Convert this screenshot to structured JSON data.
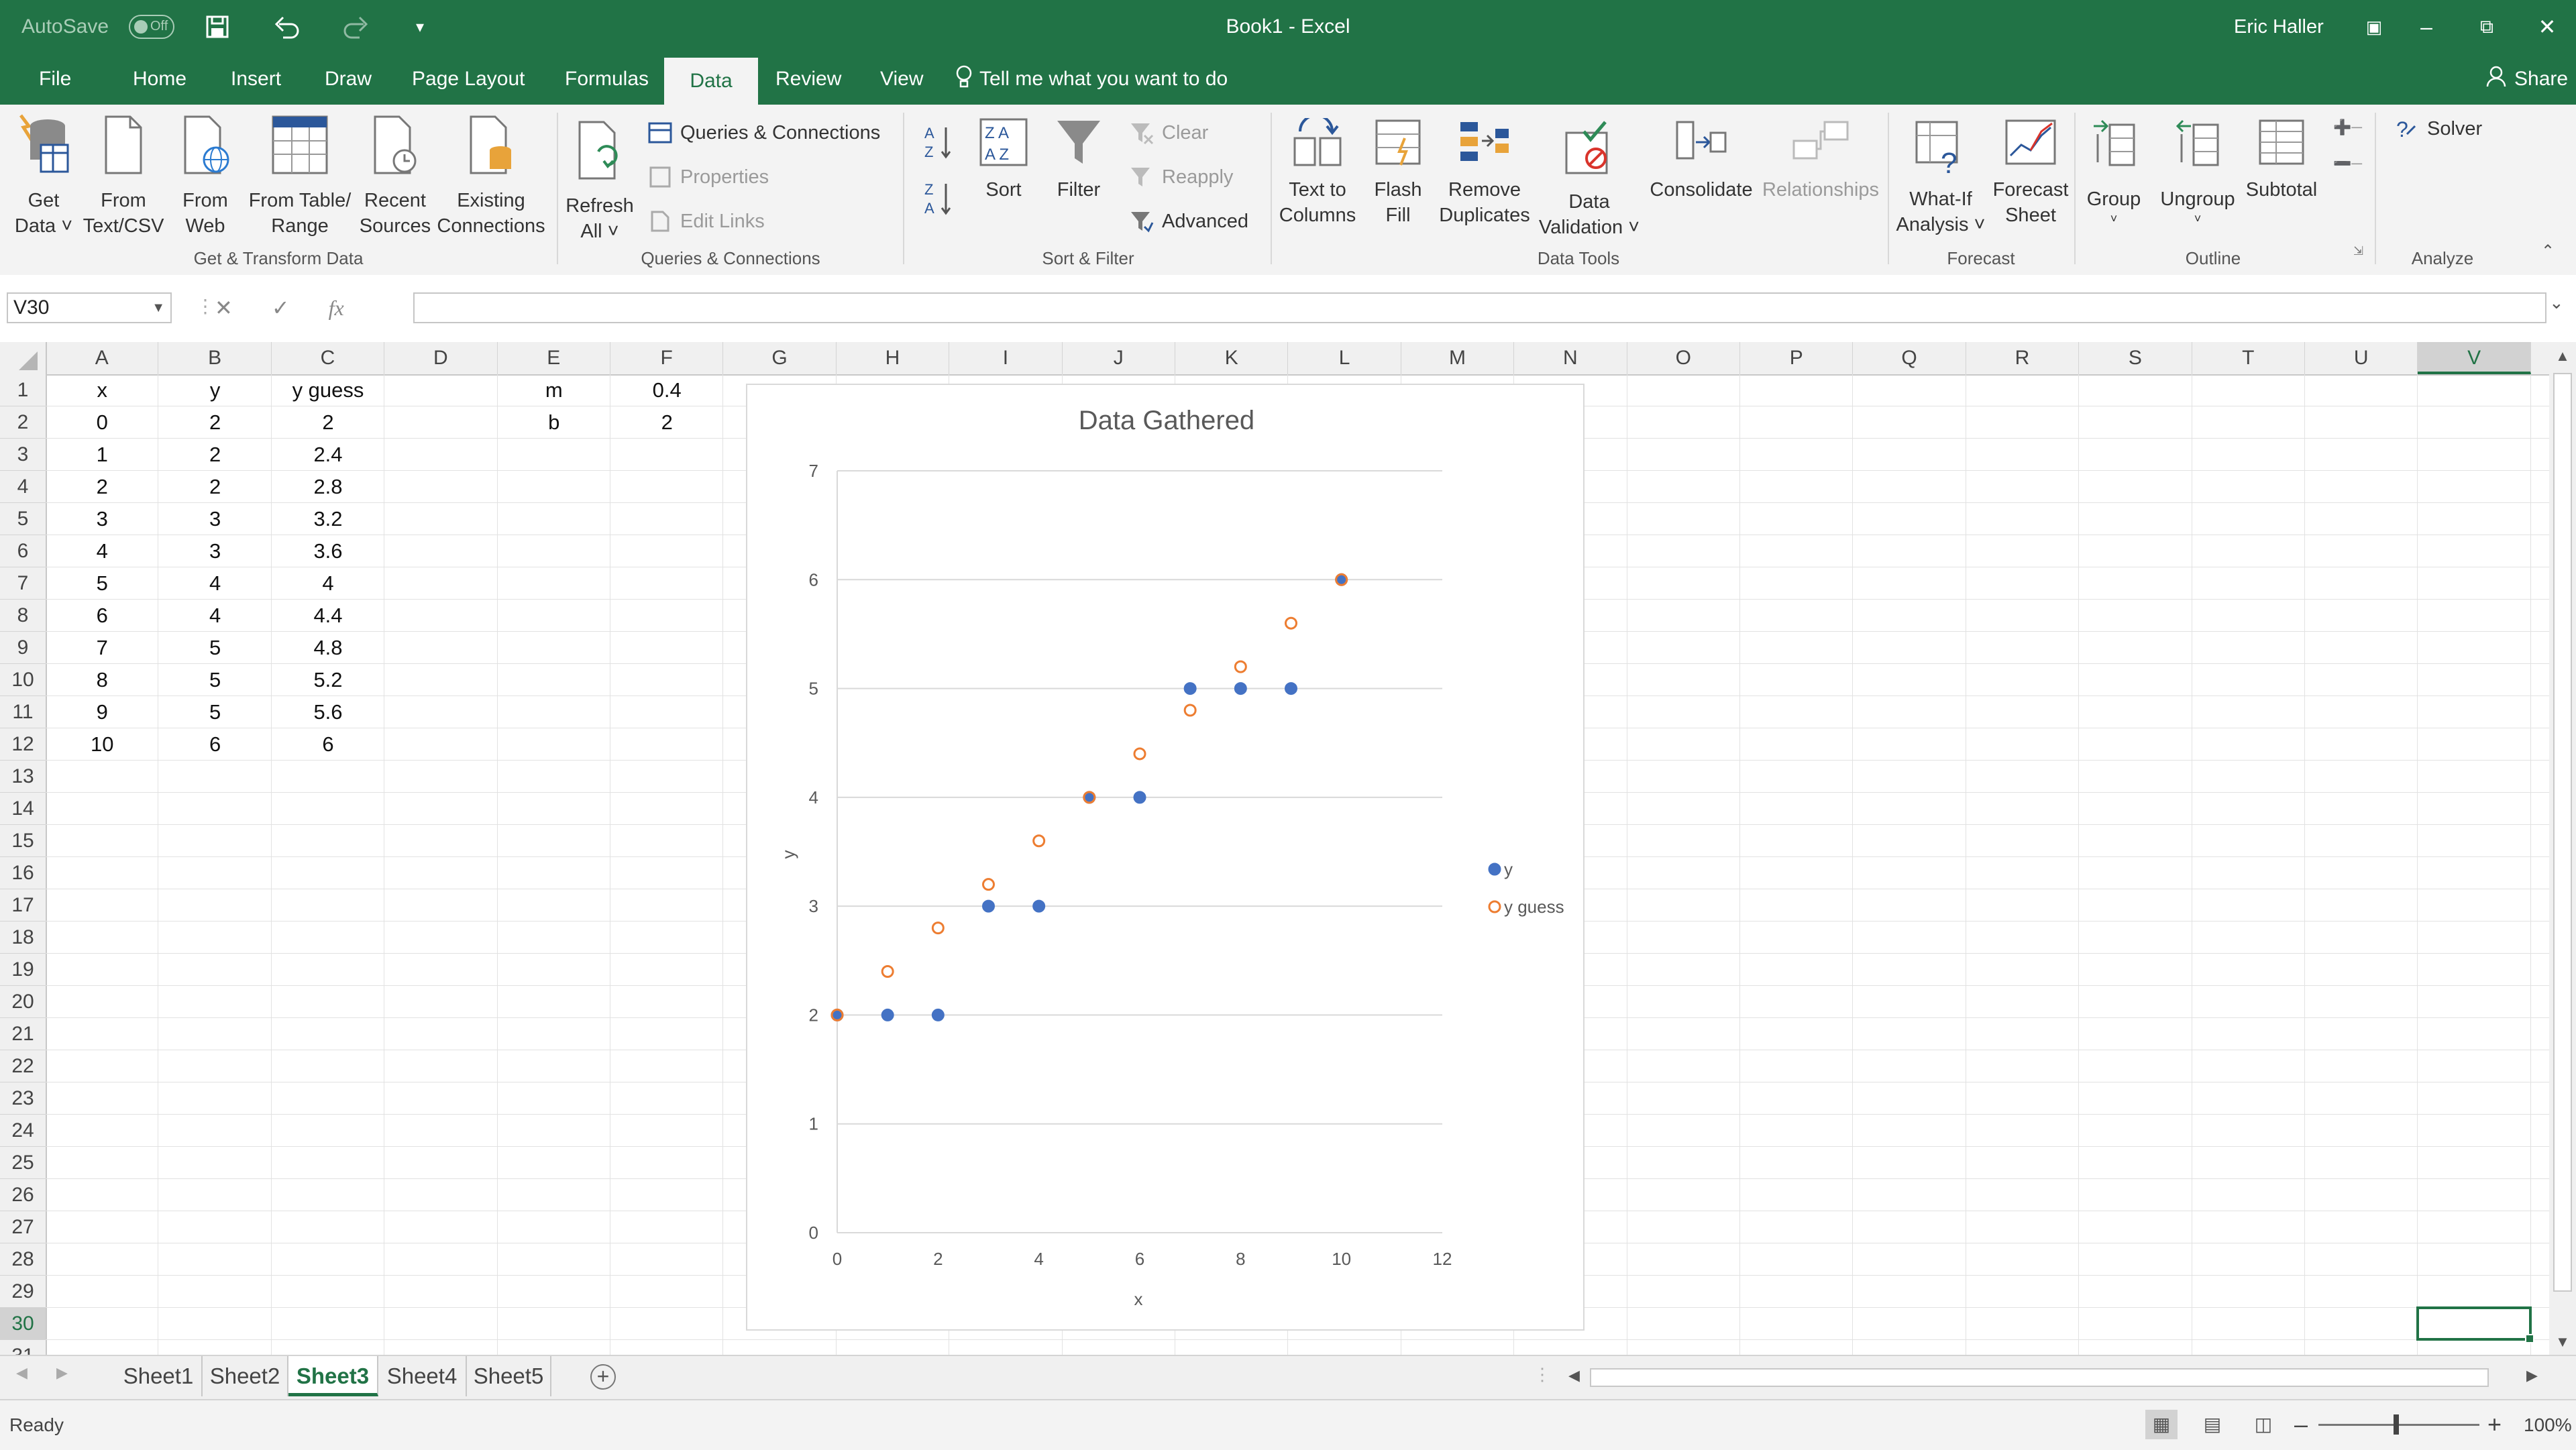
{
  "window": {
    "title": "Book1  -  Excel",
    "user": "Eric Haller",
    "autosave_label": "AutoSave",
    "autosave_state": "Off"
  },
  "tabs": [
    "File",
    "Home",
    "Insert",
    "Draw",
    "Page Layout",
    "Formulas",
    "Data",
    "Review",
    "View"
  ],
  "active_tab": "Data",
  "tell_me": "Tell me what you want to do",
  "share": "Share",
  "ribbon": {
    "get_transform": {
      "label": "Get & Transform Data",
      "get_data": [
        "Get",
        "Data ˅"
      ],
      "from_text": [
        "From",
        "Text/CSV"
      ],
      "from_web": [
        "From",
        "Web"
      ],
      "from_table": [
        "From Table/",
        "Range"
      ],
      "recent_sources": [
        "Recent",
        "Sources"
      ],
      "existing_connections": [
        "Existing",
        "Connections"
      ]
    },
    "queries": {
      "label": "Queries & Connections",
      "refresh_all": [
        "Refresh",
        "All ˅"
      ],
      "queries_connections": "Queries & Connections",
      "properties": "Properties",
      "edit_links": "Edit Links"
    },
    "sort_filter": {
      "label": "Sort & Filter",
      "sort": "Sort",
      "filter": "Filter",
      "clear": "Clear",
      "reapply": "Reapply",
      "advanced": "Advanced"
    },
    "data_tools": {
      "label": "Data Tools",
      "text_to_columns": [
        "Text to",
        "Columns"
      ],
      "flash_fill": [
        "Flash",
        "Fill"
      ],
      "remove_duplicates": [
        "Remove",
        "Duplicates"
      ],
      "data_validation": [
        "Data",
        "Validation ˅"
      ],
      "consolidate": "Consolidate",
      "relationships": "Relationships"
    },
    "forecast": {
      "label": "Forecast",
      "what_if": [
        "What-If",
        "Analysis ˅"
      ],
      "forecast_sheet": [
        "Forecast",
        "Sheet"
      ]
    },
    "outline": {
      "label": "Outline",
      "group": "Group",
      "ungroup": "Ungroup",
      "subtotal": "Subtotal"
    },
    "analyze": {
      "label": "Analyze",
      "solver": "Solver"
    }
  },
  "formula_bar": {
    "name_box": "V30",
    "fx": "fx",
    "formula": ""
  },
  "columns": [
    "A",
    "B",
    "C",
    "D",
    "E",
    "F",
    "G",
    "H",
    "I",
    "J",
    "K",
    "L",
    "M",
    "N",
    "O",
    "P",
    "Q",
    "R",
    "S",
    "T",
    "U",
    "V"
  ],
  "selected_column": "V",
  "rows": [
    "1",
    "2",
    "3",
    "4",
    "5",
    "6",
    "7",
    "8",
    "9",
    "10",
    "11",
    "12",
    "13",
    "14",
    "15",
    "16",
    "17",
    "18",
    "19",
    "20",
    "21",
    "22",
    "23",
    "24",
    "25",
    "26",
    "27",
    "28",
    "29",
    "30",
    "31"
  ],
  "selected_row": "30",
  "table": {
    "headers": [
      "x",
      "y",
      "y guess"
    ],
    "rows": [
      [
        "0",
        "2",
        "2"
      ],
      [
        "1",
        "2",
        "2.4"
      ],
      [
        "2",
        "2",
        "2.8"
      ],
      [
        "3",
        "3",
        "3.2"
      ],
      [
        "4",
        "3",
        "3.6"
      ],
      [
        "5",
        "4",
        "4"
      ],
      [
        "6",
        "4",
        "4.4"
      ],
      [
        "7",
        "5",
        "4.8"
      ],
      [
        "8",
        "5",
        "5.2"
      ],
      [
        "9",
        "5",
        "5.6"
      ],
      [
        "10",
        "6",
        "6"
      ]
    ]
  },
  "params": [
    [
      "m",
      "0.4"
    ],
    [
      "b",
      "2"
    ]
  ],
  "chart_data": {
    "type": "scatter",
    "title": "Data Gathered",
    "xlabel": "x",
    "ylabel": "y",
    "xlim": [
      0,
      12
    ],
    "ylim": [
      0,
      7
    ],
    "xticks": [
      0,
      2,
      4,
      6,
      8,
      10,
      12
    ],
    "yticks": [
      0,
      1,
      2,
      3,
      4,
      5,
      6,
      7
    ],
    "grid": "horizontal",
    "legend": "right",
    "series": [
      {
        "name": "y",
        "color": "#4472c4",
        "marker": "filled-circle",
        "x": [
          0,
          1,
          2,
          3,
          4,
          5,
          6,
          7,
          8,
          9,
          10
        ],
        "y": [
          2,
          2,
          2,
          3,
          3,
          4,
          4,
          5,
          5,
          5,
          6
        ]
      },
      {
        "name": "y guess",
        "color": "#ed7d31",
        "marker": "hollow-circle",
        "x": [
          0,
          1,
          2,
          3,
          4,
          5,
          6,
          7,
          8,
          9,
          10
        ],
        "y": [
          2,
          2.4,
          2.8,
          3.2,
          3.6,
          4,
          4.4,
          4.8,
          5.2,
          5.6,
          6
        ]
      }
    ]
  },
  "sheets": [
    "Sheet1",
    "Sheet2",
    "Sheet3",
    "Sheet4",
    "Sheet5"
  ],
  "active_sheet": "Sheet3",
  "status": {
    "text": "Ready",
    "zoom": "100%"
  },
  "colors": {
    "accent": "#217346",
    "series_y": "#4472c4",
    "series_guess": "#ed7d31"
  }
}
